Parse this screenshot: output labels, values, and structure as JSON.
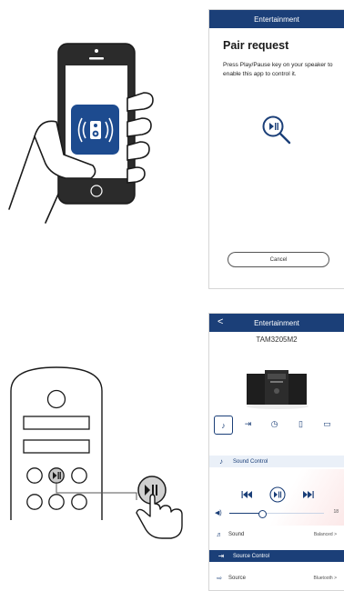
{
  "pair_screen": {
    "header_title": "Entertainment",
    "title": "Pair request",
    "instruction": "Press Play/Pause key on your speaker to enable this app to control it.",
    "cancel_label": "Cancel"
  },
  "control_screen": {
    "header_title": "Entertainment",
    "back_label": "<",
    "model_name": "TAM3205M2",
    "tabs": [
      {
        "icon": "sound-control-icon",
        "selected": true
      },
      {
        "icon": "source-control-icon",
        "selected": false
      },
      {
        "icon": "timer-icon",
        "selected": false
      },
      {
        "icon": "device-icon",
        "selected": false
      },
      {
        "icon": "manual-icon",
        "selected": false
      }
    ],
    "sound_control_label": "Sound Control",
    "volume_max": "18",
    "volume_level_fraction": 0.32,
    "sound_label": "Sound",
    "sound_value": "Balanced",
    "source_control_label": "Source Control",
    "source_label": "Source",
    "source_value": "Bluetooth",
    "chevron": ">"
  },
  "remote": {
    "play_pause_glyph": "▶II"
  },
  "colors": {
    "primary": "#1b3f78",
    "app_icon": "#1d4b8f",
    "accent_pink": "#fce8e8"
  }
}
